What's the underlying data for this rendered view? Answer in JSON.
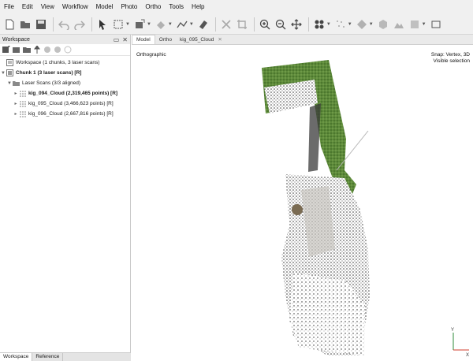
{
  "menubar": [
    "File",
    "Edit",
    "View",
    "Workflow",
    "Model",
    "Photo",
    "Ortho",
    "Tools",
    "Help"
  ],
  "workspace": {
    "title": "Workspace",
    "root": "Workspace (1 chunks, 3 laser scans)",
    "chunk": "Chunk 1 (3 laser scans) [R]",
    "group": "Laser Scans (3/3 aligned)",
    "scans": [
      {
        "label": "kig_094_Cloud (2,319,465 points) [R]",
        "bold": true
      },
      {
        "label": "kig_095_Cloud (3,466,623 points) [R]",
        "bold": false
      },
      {
        "label": "kig_096_Cloud (2,667,816 points) [R]",
        "bold": false
      }
    ]
  },
  "bottom_tabs": [
    "Workspace",
    "Reference"
  ],
  "view": {
    "tabs": [
      "Model",
      "Ortho",
      "kig_095_Cloud"
    ],
    "projection": "Orthographic",
    "snap": "Snap: Vertex, 3D",
    "selection": "Visible selection",
    "axis_y": "Y",
    "axis_x": "X"
  },
  "colors": {
    "grass": "#5d8a3a",
    "dark": "#3a3a3a",
    "accent": "#d23b2b"
  }
}
